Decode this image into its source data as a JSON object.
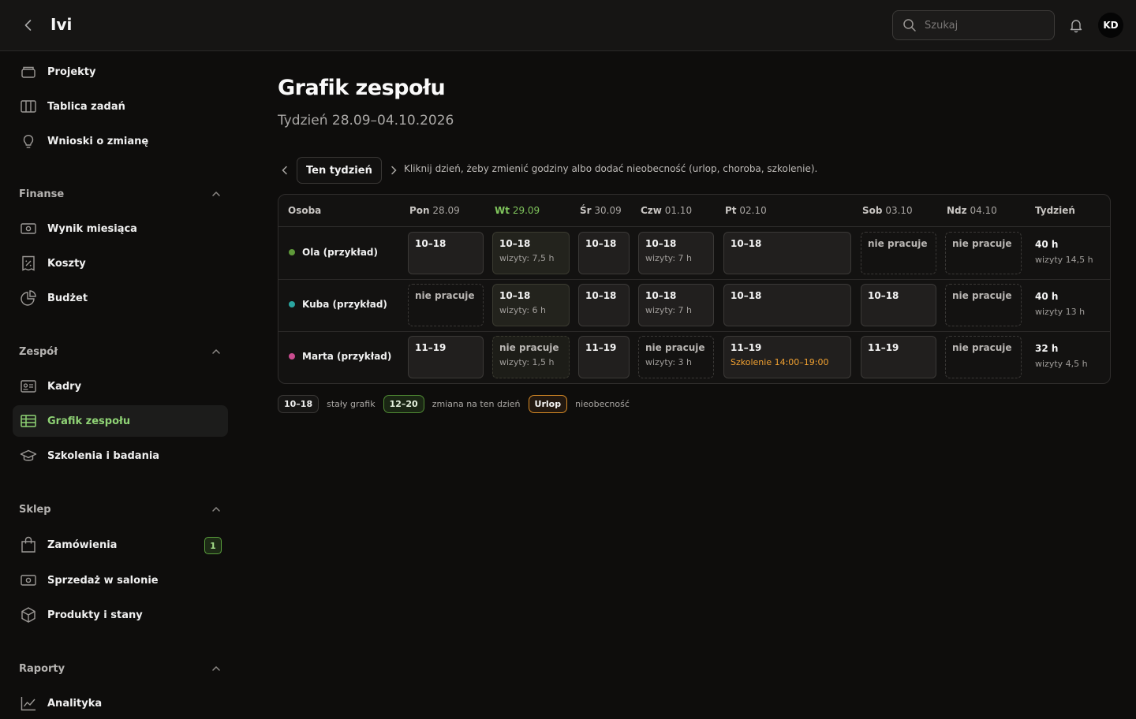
{
  "app": {
    "title": "Ivi",
    "avatar_initials": "KD"
  },
  "search": {
    "placeholder": "Szukaj"
  },
  "sidebar": {
    "top_items": [
      {
        "label": "Projekty",
        "icon": "archive-box-icon"
      },
      {
        "label": "Tablica zadań",
        "icon": "columns-icon"
      },
      {
        "label": "Wnioski o zmianę",
        "icon": "lightbulb-icon"
      }
    ],
    "sections": [
      {
        "label": "Finanse",
        "items": [
          {
            "label": "Wynik miesiąca",
            "icon": "banknote-icon"
          },
          {
            "label": "Koszty",
            "icon": "receipt-percent-icon"
          },
          {
            "label": "Budżet",
            "icon": "pie-chart-icon"
          }
        ]
      },
      {
        "label": "Zespół",
        "items": [
          {
            "label": "Kadry",
            "icon": "id-card-icon"
          },
          {
            "label": "Grafik zespołu",
            "icon": "table-icon",
            "active": true
          },
          {
            "label": "Szkolenia i badania",
            "icon": "graduation-cap-icon"
          }
        ]
      },
      {
        "label": "Sklep",
        "items": [
          {
            "label": "Zamówienia",
            "icon": "shopping-bag-icon",
            "badge": "1"
          },
          {
            "label": "Sprzedaż w salonie",
            "icon": "banknote-icon"
          },
          {
            "label": "Produkty i stany",
            "icon": "cube-icon"
          }
        ]
      },
      {
        "label": "Raporty",
        "items": [
          {
            "label": "Analityka",
            "icon": "line-chart-icon"
          }
        ]
      }
    ]
  },
  "page": {
    "title": "Grafik zespołu",
    "week": "Tydzień 28.09–04.10.2026",
    "this_week_label": "Ten tydzień",
    "hint": "Kliknij dzień, żeby zmienić godziny albo dodać nieobecność (urlop, choroba, szkolenie)."
  },
  "schedule": {
    "columns": [
      {
        "day": "Osoba",
        "date": ""
      },
      {
        "day": "Pon",
        "date": "28.09"
      },
      {
        "day": "Wt",
        "date": "29.09",
        "today": true
      },
      {
        "day": "Śr",
        "date": "30.09"
      },
      {
        "day": "Czw",
        "date": "01.10"
      },
      {
        "day": "Pt",
        "date": "02.10"
      },
      {
        "day": "Sob",
        "date": "03.10"
      },
      {
        "day": "Ndz",
        "date": "04.10"
      },
      {
        "day": "Tydzień",
        "date": ""
      }
    ],
    "rows": [
      {
        "name": "Ola (przykład)",
        "color": "#5f9a3a",
        "cells": [
          {
            "text": "10–18",
            "sub": ""
          },
          {
            "text": "10–18",
            "sub": "wizyty: 7,5 h"
          },
          {
            "text": "10–18",
            "sub": ""
          },
          {
            "text": "10–18",
            "sub": "wizyty: 7 h"
          },
          {
            "text": "10–18",
            "sub": ""
          },
          {
            "text": "nie pracuje",
            "sub": "",
            "off": true
          },
          {
            "text": "nie pracuje",
            "sub": "",
            "off": true
          }
        ],
        "total": "40 h",
        "total_sub": "wizyty 14,5 h"
      },
      {
        "name": "Kuba (przykład)",
        "color": "#2aa5a0",
        "cells": [
          {
            "text": "nie pracuje",
            "sub": "",
            "off": true
          },
          {
            "text": "10–18",
            "sub": "wizyty: 6 h"
          },
          {
            "text": "10–18",
            "sub": ""
          },
          {
            "text": "10–18",
            "sub": "wizyty: 7 h"
          },
          {
            "text": "10–18",
            "sub": ""
          },
          {
            "text": "10–18",
            "sub": ""
          },
          {
            "text": "nie pracuje",
            "sub": "",
            "off": true
          }
        ],
        "total": "40 h",
        "total_sub": "wizyty 13 h"
      },
      {
        "name": "Marta (przykład)",
        "color": "#c94c8f",
        "cells": [
          {
            "text": "11–19",
            "sub": ""
          },
          {
            "text": "nie pracuje",
            "sub": "wizyty: 1,5 h",
            "off": true
          },
          {
            "text": "11–19",
            "sub": ""
          },
          {
            "text": "nie pracuje",
            "sub": "wizyty: 3 h",
            "off": true
          },
          {
            "text": "11–19",
            "sub": "Szkolenie 14:00–19:00",
            "warn": true
          },
          {
            "text": "11–19",
            "sub": ""
          },
          {
            "text": "nie pracuje",
            "sub": "",
            "off": true
          }
        ],
        "total": "32 h",
        "total_sub": "wizyty 4,5 h"
      }
    ]
  },
  "legend": {
    "fixed_chip": "10–18",
    "fixed_text": "stały grafik",
    "change_chip": "12–20",
    "change_text": "zmiana na ten dzień",
    "leave_chip": "Urlop",
    "leave_text": "nieobecność"
  }
}
